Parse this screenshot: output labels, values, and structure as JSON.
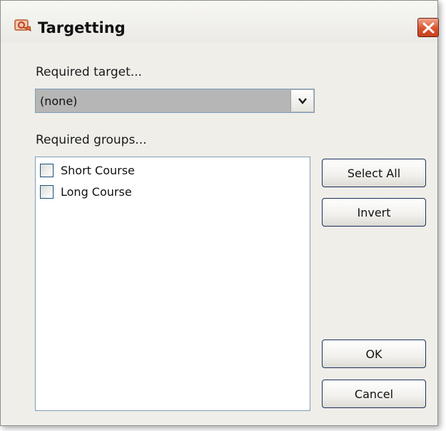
{
  "window": {
    "title": "Targetting"
  },
  "target": {
    "label": "Required target...",
    "selected": "(none)"
  },
  "groups": {
    "label": "Required groups...",
    "items": [
      {
        "label": "Short Course",
        "checked": false
      },
      {
        "label": "Long Course",
        "checked": false
      }
    ]
  },
  "buttons": {
    "select_all": "Select All",
    "invert": "Invert",
    "ok": "OK",
    "cancel": "Cancel"
  },
  "colors": {
    "dialog_bg": "#efeee9",
    "close_button": "#d9542e",
    "border": "#7f9db9"
  },
  "icons": {
    "app": "target-app-icon",
    "close": "close-icon",
    "dropdown": "chevron-down-icon"
  }
}
